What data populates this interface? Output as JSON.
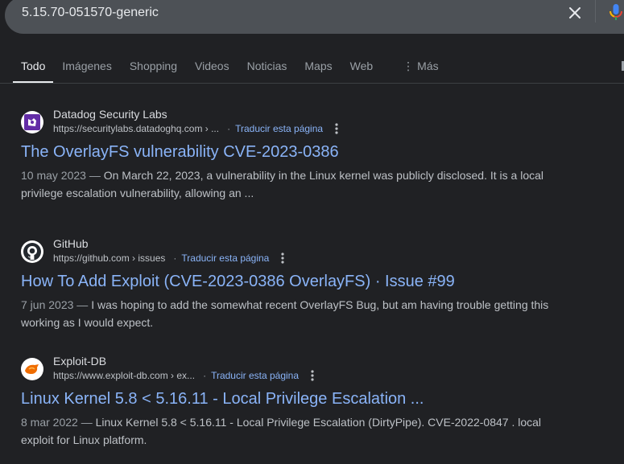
{
  "search": {
    "query": "5.15.70-051570-generic"
  },
  "tabs": [
    {
      "label": "Todo"
    },
    {
      "label": "Imágenes"
    },
    {
      "label": "Shopping"
    },
    {
      "label": "Videos"
    },
    {
      "label": "Noticias"
    },
    {
      "label": "Maps"
    },
    {
      "label": "Web"
    },
    {
      "label": "Más"
    }
  ],
  "results": [
    {
      "site": "Datadog Security Labs",
      "url": "https://securitylabs.datadoghq.com › ...",
      "translate": "Traducir esta página",
      "title": "The OverlayFS vulnerability CVE-2023-0386",
      "date": "10 may 2023",
      "snippet": "On March 22, 2023, a vulnerability in the Linux kernel was publicly disclosed. It is a local privilege escalation vulnerability, allowing an ...",
      "icon": "datadog-icon"
    },
    {
      "site": "GitHub",
      "url": "https://github.com › issues",
      "translate": "Traducir esta página",
      "title": "How To Add Exploit (CVE-2023-0386 OverlayFS) · Issue #99",
      "date": "7 jun 2023",
      "snippet": "I was hoping to add the somewhat recent OverlayFS Bug, but am having trouble getting this working as I would expect.",
      "icon": "github-icon"
    },
    {
      "site": "Exploit-DB",
      "url": "https://www.exploit-db.com › ex...",
      "translate": "Traducir esta página",
      "title": "Linux Kernel 5.8 < 5.16.11 - Local Privilege Escalation ...",
      "date": "8 mar 2022",
      "snippet": "Linux Kernel 5.8 < 5.16.11 - Local Privilege Escalation (DirtyPipe). CVE-2022-0847 . local exploit for Linux platform.",
      "icon": "exploitdb-icon"
    }
  ],
  "colors": {
    "background": "#202124",
    "link": "#8ab4f8",
    "searchbar": "#4d5156"
  }
}
